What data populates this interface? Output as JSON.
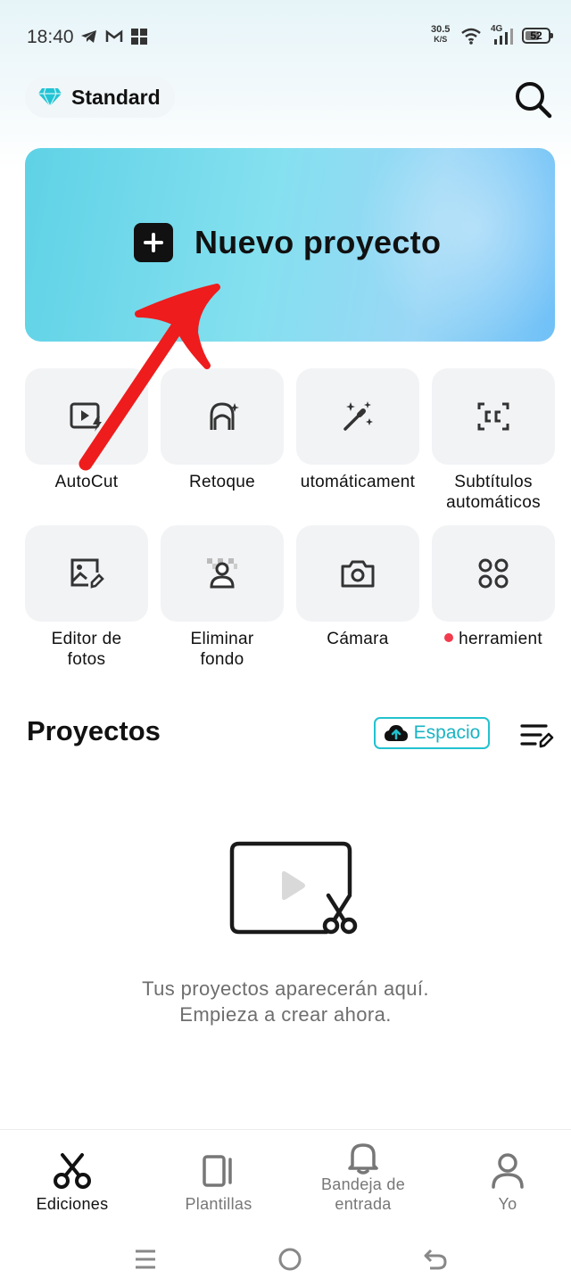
{
  "status_bar": {
    "time": "18:40",
    "net_speed_value": "30.5",
    "net_speed_unit": "K/S",
    "network_type": "4G",
    "battery_level": "52",
    "icons": [
      "telegram-icon",
      "gmail-icon",
      "microsoft-icon",
      "wifi-icon",
      "signal-icon",
      "battery-icon"
    ]
  },
  "header": {
    "plan_label": "Standard",
    "plan_icon": "diamond-icon",
    "search_icon": "search-icon"
  },
  "new_project": {
    "label": "Nuevo proyecto",
    "icon": "plus-icon"
  },
  "tools": [
    {
      "label": "AutoCut",
      "icon": "autocut-icon"
    },
    {
      "label": "Retoque",
      "icon": "retouch-icon"
    },
    {
      "label": "utomáticament",
      "icon": "magic-wand-icon"
    },
    {
      "label_line1": "Subtítulos",
      "label_line2": "automáticos",
      "icon": "captions-icon"
    },
    {
      "label_line1": "Editor de",
      "label_line2": "fotos",
      "icon": "photo-edit-icon"
    },
    {
      "label_line1": "Eliminar",
      "label_line2": "fondo",
      "icon": "remove-background-icon"
    },
    {
      "label": "Cámara",
      "icon": "camera-icon"
    },
    {
      "label": "herramient",
      "icon": "all-tools-icon",
      "badge_color": "#f23b4d"
    }
  ],
  "projects": {
    "title": "Proyectos",
    "space_button": "Espacio",
    "empty_line1": "Tus proyectos aparecerán aquí.",
    "empty_line2": "Empieza a crear ahora."
  },
  "bottom_nav": [
    {
      "label": "Ediciones",
      "icon": "scissors-icon",
      "active": true
    },
    {
      "label": "Plantillas",
      "icon": "templates-icon",
      "active": false
    },
    {
      "label_line1": "Bandeja de",
      "label_line2": "entrada",
      "icon": "bell-icon",
      "active": false
    },
    {
      "label": "Yo",
      "icon": "profile-icon",
      "active": false
    }
  ],
  "colors": {
    "accent": "#22c2cf",
    "banner_start": "#5fd2e6",
    "banner_end": "#6fc0f7",
    "annotation_arrow": "#ee1c1c",
    "badge_dot": "#f23b4d"
  }
}
